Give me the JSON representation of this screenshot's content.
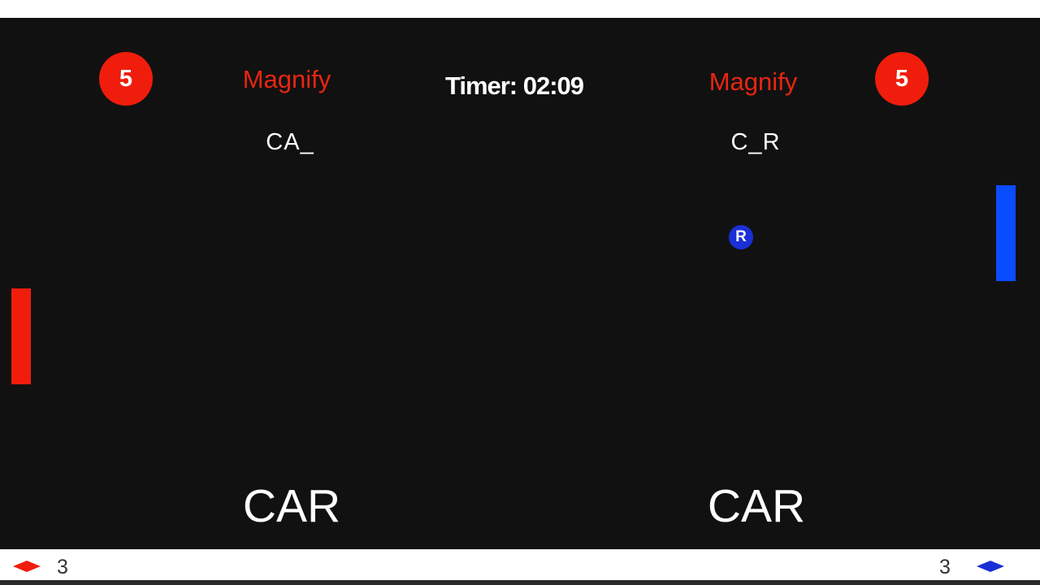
{
  "timer": {
    "label": "Timer: 02:09"
  },
  "left_player": {
    "score": "5",
    "powerup": "Magnify",
    "word_progress": "CA_",
    "target_word": "CAR",
    "lives": "3",
    "color": "#f01d0c",
    "lives_icon": "red-diamond-icon"
  },
  "right_player": {
    "score": "5",
    "powerup": "Magnify",
    "word_progress": "C_R",
    "target_word": "CAR",
    "lives": "3",
    "color": "#0a4cff",
    "lives_icon": "blue-diamond-icon"
  },
  "ball": {
    "letter": "R",
    "color": "#1a2fd6"
  }
}
